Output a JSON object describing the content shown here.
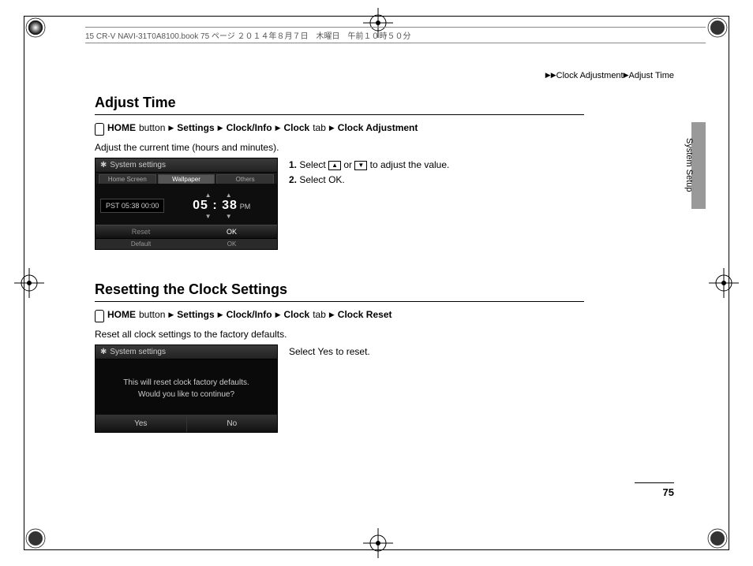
{
  "header_file_info": "15 CR-V NAVI-31T0A8100.book  75 ページ  ２０１４年８月７日　木曜日　午前１０時５０分",
  "breadcrumb_top": {
    "arrows": "▶▶",
    "b1": "Clock Adjustment",
    "arrow2": "▶",
    "b2": "Adjust Time"
  },
  "side_section": "System Setup",
  "page_number": "75",
  "section1": {
    "title": "Adjust Time",
    "path": {
      "home": "HOME",
      "p1": "button",
      "p2": "Settings",
      "p3": "Clock/Info",
      "p4": "Clock",
      "p5": "tab",
      "p6": "Clock Adjustment"
    },
    "desc": "Adjust the current time (hours and minutes).",
    "screen": {
      "title": "System settings",
      "tab1": "Home Screen",
      "tab2": "Wallpaper",
      "tab3": "Others",
      "pst": "PST 05:38   00:00",
      "up_arrows": "▲   ▲",
      "time": "05 : 38",
      "pm": "PM",
      "down_arrows": "▼   ▼",
      "reset": "Reset",
      "ok": "OK",
      "foot_default": "Default",
      "foot_ok": "OK"
    },
    "steps": {
      "s1a": "Select",
      "up": "▲",
      "or": "or",
      "down": "▼",
      "s1b": "to adjust the value.",
      "s2a": "Select",
      "s2b": "OK",
      "s2c": "."
    }
  },
  "section2": {
    "title": "Resetting the Clock Settings",
    "path": {
      "home": "HOME",
      "p1": "button",
      "p2": "Settings",
      "p3": "Clock/Info",
      "p4": "Clock",
      "p5": "tab",
      "p6": "Clock Reset"
    },
    "desc": "Reset all clock settings to the factory defaults.",
    "screen": {
      "title": "System settings",
      "msg1": "This will reset clock factory defaults.",
      "msg2": "Would you like to continue?",
      "yes": "Yes",
      "no": "No"
    },
    "instr_a": "Select",
    "instr_b": "Yes",
    "instr_c": "to reset."
  }
}
